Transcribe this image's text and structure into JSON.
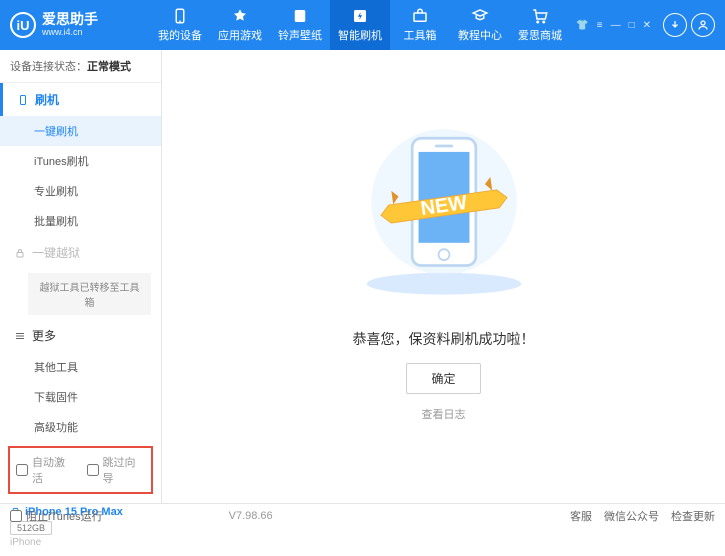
{
  "header": {
    "logo_letter": "iU",
    "logo_title": "爱思助手",
    "logo_url": "www.i4.cn",
    "nav": [
      {
        "label": "我的设备"
      },
      {
        "label": "应用游戏"
      },
      {
        "label": "铃声壁纸"
      },
      {
        "label": "智能刷机"
      },
      {
        "label": "工具箱"
      },
      {
        "label": "教程中心"
      },
      {
        "label": "爱思商城"
      }
    ]
  },
  "sidebar": {
    "status_label": "设备连接状态：",
    "status_value": "正常模式",
    "section_flash": "刷机",
    "items_flash": [
      "一键刷机",
      "iTunes刷机",
      "专业刷机",
      "批量刷机"
    ],
    "section_jailbreak": "一键越狱",
    "jailbreak_note": "越狱工具已转移至工具箱",
    "section_more": "更多",
    "items_more": [
      "其他工具",
      "下载固件",
      "高级功能"
    ],
    "checkbox1": "自动激活",
    "checkbox2": "跳过向导",
    "device_name": "iPhone 15 Pro Max",
    "device_capacity": "512GB",
    "device_type": "iPhone"
  },
  "main": {
    "banner": "NEW",
    "success_text": "恭喜您，保资料刷机成功啦！",
    "ok_label": "确定",
    "log_link": "查看日志"
  },
  "footer": {
    "block_itunes": "阻止iTunes运行",
    "version": "V7.98.66",
    "links": [
      "客服",
      "微信公众号",
      "检查更新"
    ]
  }
}
